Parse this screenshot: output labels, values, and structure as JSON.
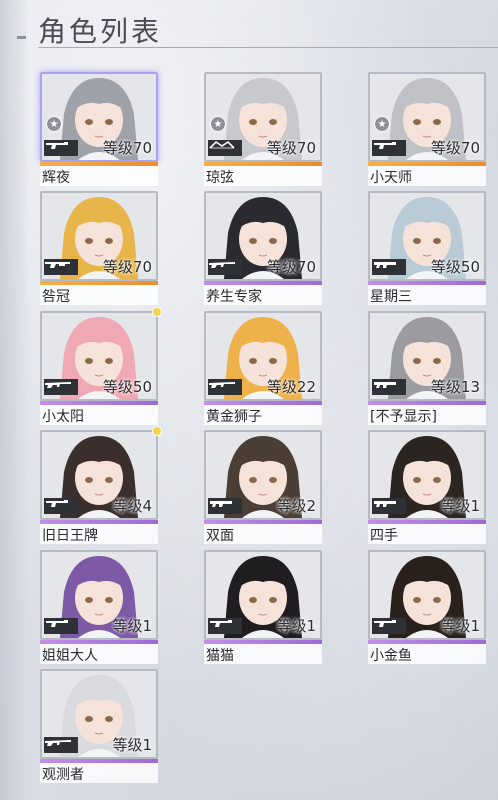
{
  "header": {
    "title": "角色列表"
  },
  "colors": {
    "orange_rarity": "#f0a53c",
    "purple_rarity": "#b77ee0",
    "selected_glow": "#a7a3ee",
    "notify": "#f2d34a"
  },
  "characters": [
    {
      "name": "辉夜",
      "level": "等级70",
      "rarity": "orange",
      "weapon": "pistol-icon",
      "star": true,
      "selected": true,
      "hair": "#9fa2a8"
    },
    {
      "name": "琼弦",
      "level": "等级70",
      "rarity": "orange",
      "weapon": "bow-icon",
      "star": true,
      "hair": "#c7c9cd"
    },
    {
      "name": "小天师",
      "level": "等级70",
      "rarity": "orange",
      "weapon": "pistol-icon",
      "star": true,
      "hair": "#bfc1c6"
    },
    {
      "name": "咎冠",
      "level": "等级70",
      "rarity": "orange",
      "weapon": "shotgun-icon",
      "hair": "#e7b54a"
    },
    {
      "name": "养生专家",
      "level": "等级70",
      "rarity": "purple",
      "weapon": "rifle-icon",
      "hair": "#2b2a30"
    },
    {
      "name": "星期三",
      "level": "等级50",
      "rarity": "purple",
      "weapon": "smg-icon",
      "hair": "#b9cbd6"
    },
    {
      "name": "小太阳",
      "level": "等级50",
      "rarity": "purple",
      "weapon": "rifle-icon",
      "notify": true,
      "hair": "#f0a9b4"
    },
    {
      "name": "黄金狮子",
      "level": "等级22",
      "rarity": "purple",
      "weapon": "rifle-icon",
      "hair": "#efb24b"
    },
    {
      "name": "[不予显示]",
      "level": "等级13",
      "rarity": "purple",
      "weapon": "smg-icon",
      "hair": "#9b9ba0"
    },
    {
      "name": "旧日王牌",
      "level": "等级4",
      "rarity": "purple",
      "weapon": "pistol-icon",
      "notify": true,
      "hair": "#3b2f2d"
    },
    {
      "name": "双面",
      "level": "等级2",
      "rarity": "purple",
      "weapon": "smg-icon",
      "hair": "#4b3e35"
    },
    {
      "name": "四手",
      "level": "等级1",
      "rarity": "purple",
      "weapon": "smg-icon",
      "hair": "#2c2623"
    },
    {
      "name": "姐姐大人",
      "level": "等级1",
      "rarity": "purple",
      "weapon": "pistol-icon",
      "hair": "#7d59a6"
    },
    {
      "name": "猫猫",
      "level": "等级1",
      "rarity": "purple",
      "weapon": "pistol-icon",
      "hair": "#1f1d20"
    },
    {
      "name": "小金鱼",
      "level": "等级1",
      "rarity": "purple",
      "weapon": "pistol-icon",
      "hair": "#2a211d"
    },
    {
      "name": "观测者",
      "level": "等级1",
      "rarity": "purple",
      "weapon": "rifle-icon",
      "hair": "#d9dadd"
    }
  ]
}
